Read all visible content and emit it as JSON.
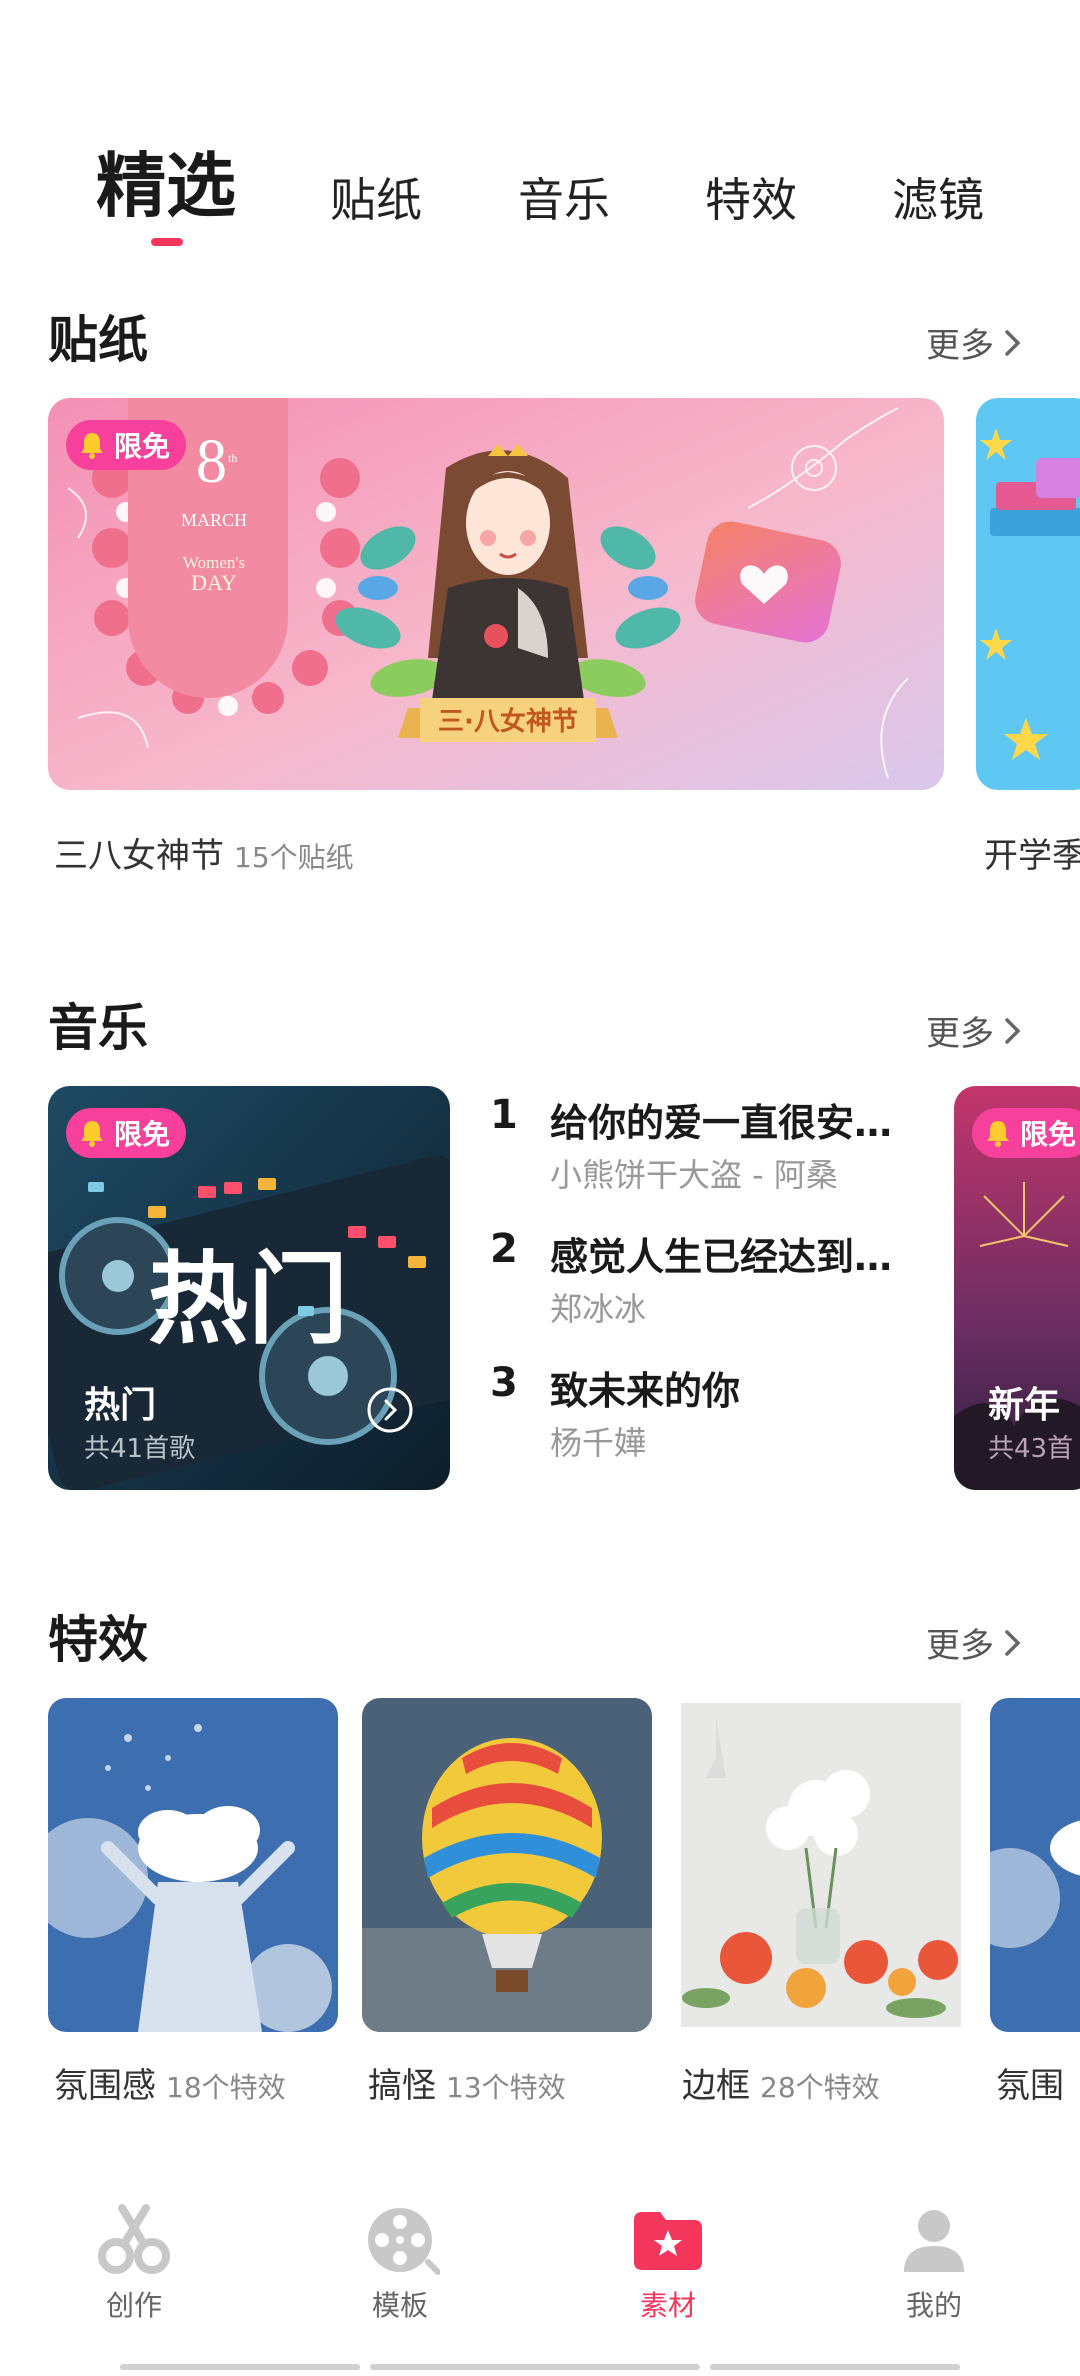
{
  "colors": {
    "accent": "#f5365c",
    "badge_pink": "#f6409b",
    "icon_gray": "#c8c8c8"
  },
  "tabs": [
    {
      "label": "精选",
      "active": true
    },
    {
      "label": "贴纸",
      "active": false
    },
    {
      "label": "音乐",
      "active": false
    },
    {
      "label": "特效",
      "active": false
    },
    {
      "label": "滤镜",
      "active": false
    }
  ],
  "stickers": {
    "title": "贴纸",
    "more_label": "更多",
    "badge": "限免",
    "banner_text": {
      "day": "8",
      "th": "th",
      "month": "MARCH",
      "line1": "Women's",
      "line2": "DAY",
      "ribbon": "三·八女神节"
    },
    "items": [
      {
        "name": "三八女神节",
        "count": "15个贴纸"
      },
      {
        "name": "开学季",
        "count": ""
      }
    ]
  },
  "music": {
    "title": "音乐",
    "more_label": "更多",
    "badge": "限免",
    "playlist": {
      "cover_text": "热门",
      "name": "热门",
      "count": "共41首歌"
    },
    "next_playlist": {
      "name": "新年",
      "count": "共43首"
    },
    "tracks": [
      {
        "num": "1",
        "title": "给你的爱一直很安…",
        "artist": "小熊饼干大盗 - 阿桑"
      },
      {
        "num": "2",
        "title": "感觉人生已经达到…",
        "artist": "郑冰冰"
      },
      {
        "num": "3",
        "title": "致未来的你",
        "artist": "杨千嬅"
      }
    ]
  },
  "effects": {
    "title": "特效",
    "more_label": "更多",
    "items": [
      {
        "name": "氛围感",
        "count": "18个特效"
      },
      {
        "name": "搞怪",
        "count": "13个特效"
      },
      {
        "name": "边框",
        "count": "28个特效"
      },
      {
        "name": "氛围",
        "count": ""
      }
    ]
  },
  "bottom_nav": [
    {
      "label": "创作",
      "icon": "scissors-icon",
      "active": false
    },
    {
      "label": "模板",
      "icon": "film-reel-icon",
      "active": false
    },
    {
      "label": "素材",
      "icon": "folder-star-icon",
      "active": true
    },
    {
      "label": "我的",
      "icon": "person-icon",
      "active": false
    }
  ]
}
